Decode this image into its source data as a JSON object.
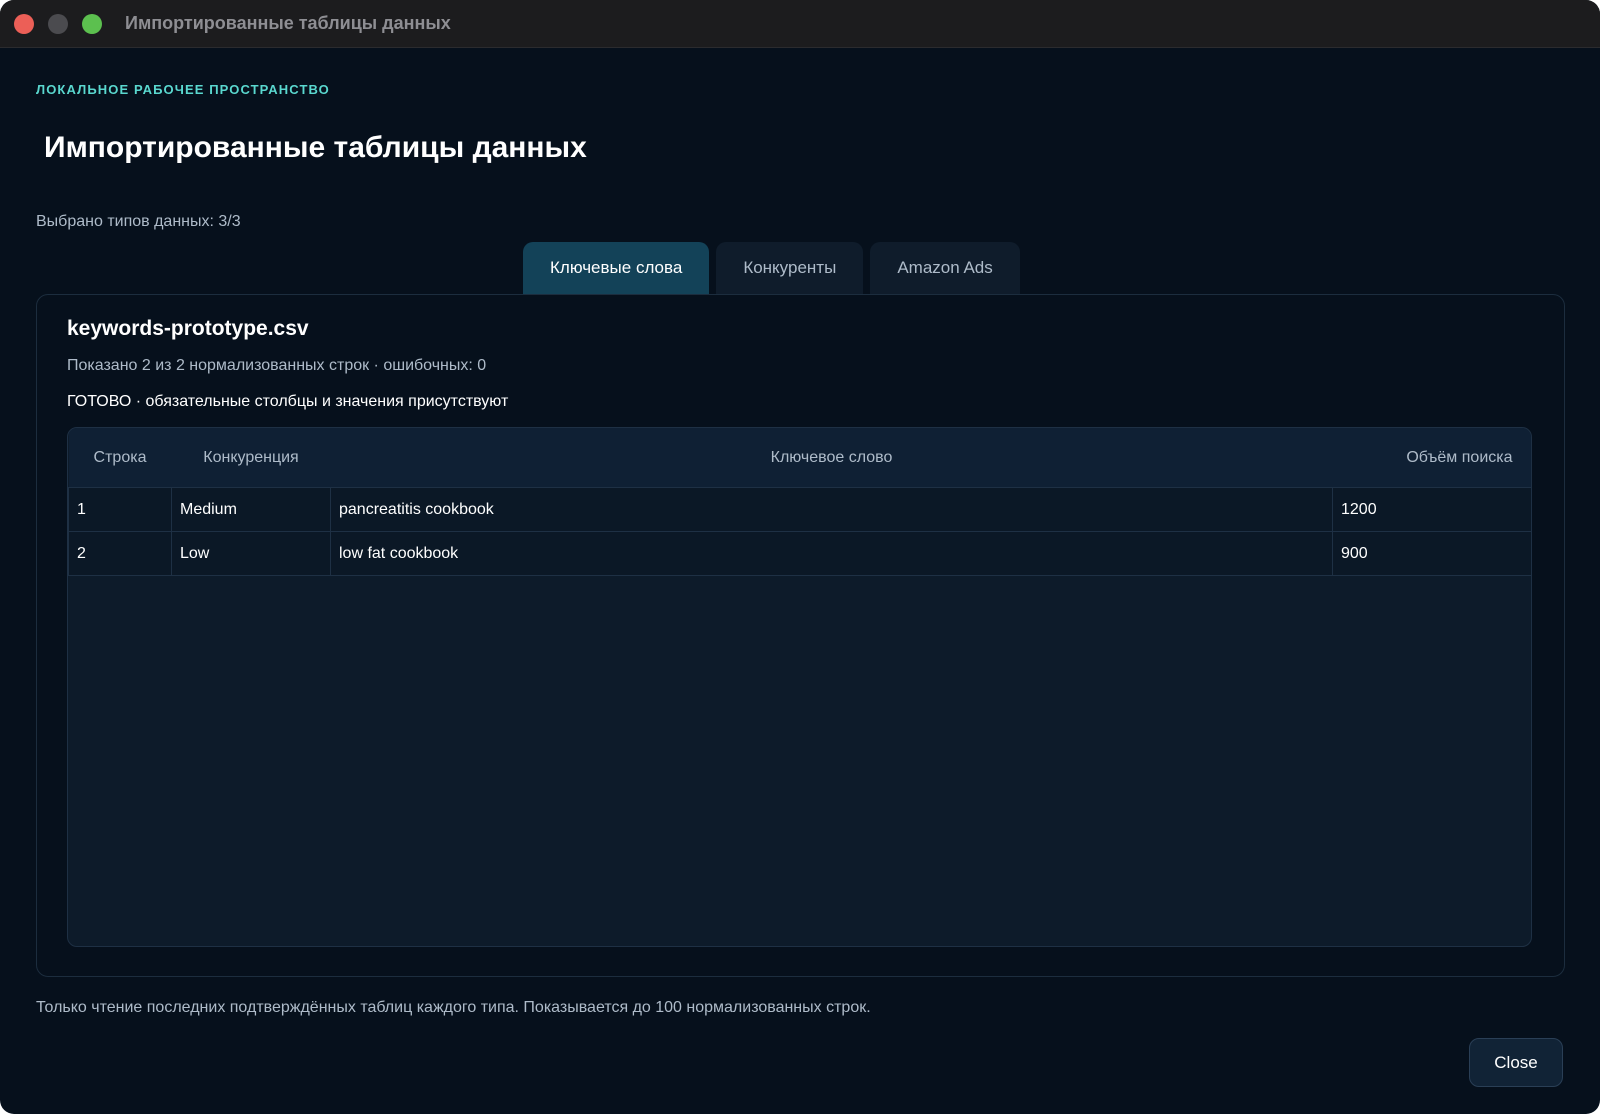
{
  "window": {
    "title": "Импортированные таблицы данных"
  },
  "header": {
    "eyebrow": "ЛОКАЛЬНОЕ РАБОЧЕЕ ПРОСТРАНСТВО",
    "title": "Импортированные таблицы данных",
    "selection_summary": "Выбрано типов данных: 3/3"
  },
  "tabs": [
    {
      "label": "Ключевые слова",
      "active": true
    },
    {
      "label": "Конкуренты",
      "active": false
    },
    {
      "label": "Amazon Ads",
      "active": false
    }
  ],
  "panel": {
    "file_name": "keywords-prototype.csv",
    "rows_summary": "Показано 2 из 2 нормализованных строк · ошибочных: 0",
    "status": "ГОТОВО · обязательные столбцы и значения присутствуют"
  },
  "table": {
    "columns": [
      "Строка",
      "Конкуренция",
      "Ключевое слово",
      "Объём поиска"
    ],
    "rows": [
      [
        "1",
        "Medium",
        "pancreatitis cookbook",
        "1200"
      ],
      [
        "2",
        "Low",
        "low fat cookbook",
        "900"
      ]
    ]
  },
  "footer": {
    "note": "Только чтение последних подтверждённых таблиц каждого типа. Показывается до 100 нормализованных строк.",
    "close_label": "Close"
  },
  "colors": {
    "background": "#06101c",
    "accent": "#5ad8cf",
    "active_tab": "#134258"
  }
}
